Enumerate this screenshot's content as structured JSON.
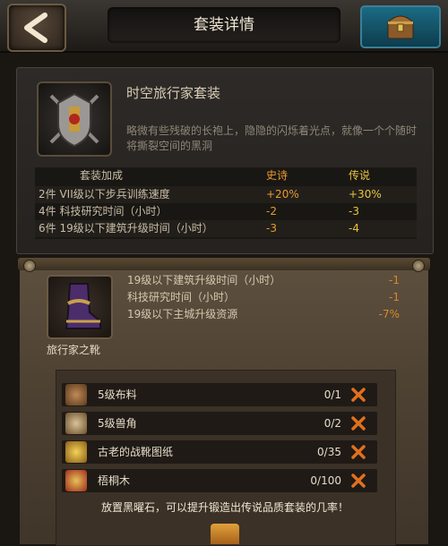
{
  "header": {
    "title": "套装详情"
  },
  "set": {
    "title": "时空旅行家套装",
    "description": "略微有些残破的长袍上，隐隐的闪烁着光点，就像一个个随时将撕裂空间的黑洞"
  },
  "bonus": {
    "headers": {
      "label": "套装加成",
      "epic": "史诗",
      "legendary": "传说"
    },
    "rows": [
      {
        "label": "2件 VII级以下步兵训练速度",
        "epic": "+20%",
        "legendary": "+30%"
      },
      {
        "label": "4件 科技研究时间（小时）",
        "epic": "-2",
        "legendary": "-3"
      },
      {
        "label": "6件 19级以下建筑升级时间（小时）",
        "epic": "-3",
        "legendary": "-4"
      }
    ]
  },
  "item": {
    "name": "旅行家之靴",
    "stats": [
      {
        "label": "19级以下建筑升级时间（小时）",
        "value": "-1"
      },
      {
        "label": "科技研究时间（小时）",
        "value": "-1"
      },
      {
        "label": "19级以下主城升级资源",
        "value": "-7%"
      }
    ]
  },
  "materials": [
    {
      "name": "5级布料",
      "count": "0/1",
      "icon": "cloth-icon"
    },
    {
      "name": "5级兽角",
      "count": "0/2",
      "icon": "horn-icon"
    },
    {
      "name": "古老的战靴图纸",
      "count": "0/35",
      "icon": "blueprint-icon"
    },
    {
      "name": "梧桐木",
      "count": "0/100",
      "icon": "wood-icon"
    }
  ],
  "tip": "放置黑曜石，可以提升锻造出传说品质套装的几率！",
  "colors": {
    "epic": "#e99a2c",
    "legendary": "#e8c43c",
    "missing": "#e0701e"
  }
}
